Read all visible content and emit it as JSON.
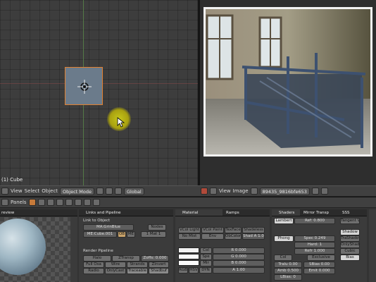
{
  "viewport": {
    "object_label": "(1) Cube",
    "menu": [
      "View",
      "Select",
      "Object"
    ],
    "mode": "Object Mode",
    "orientation": "Global"
  },
  "image_editor": {
    "menu": [
      "View",
      "Image"
    ],
    "image_name": "89435_9816bfe653"
  },
  "buttons_window": {
    "panels_label": "Panels"
  },
  "panel_preview": {
    "title": "review"
  },
  "panel_link": {
    "title": "Links and Pipeline",
    "link_to_object": "Link to Object",
    "material_name": "MA:GrinBlue",
    "nodes": "Nodes",
    "me_name": "ME:Cube.001",
    "ob_btn": "OB",
    "me_btn": "ME",
    "mat_count": "1 Mat 1",
    "render_pipeline": "Render Pipeline",
    "halo": "Halo",
    "ztransp": "ZTransp",
    "zoffs": "Zoffs: 0.000",
    "full_osa": "Full Osa",
    "wire": "Wire",
    "strands": "Strands",
    "zinvert": "ZInvert",
    "radio": "Radio",
    "only_cast": "OnlyCast",
    "traceable": "Traceable",
    "shadbuf": "Shadbuf"
  },
  "panel_material": {
    "tab_material": "Material",
    "tab_ramps": "Ramps",
    "vcol_light": "VCol Light",
    "vcol_paint": "VCol Paint",
    "tex_face": "TexFace",
    "shadeless": "Shadeless",
    "no_mist": "No Mist",
    "env": "Env",
    "obcolor": "ObColor",
    "shad_a": "Shad A 1.00",
    "col_label": "Col",
    "col_r": "R 0.000",
    "spe_label": "Spe",
    "spe_g": "G 0.000",
    "mir_label": "Mir",
    "mir_b": "B 0.000",
    "rgb": "RGB",
    "hsv": "HSV",
    "dyn": "DYN",
    "alpha": "A 1.00"
  },
  "panel_shaders": {
    "tab_shaders": "Shaders",
    "tab_mirror": "Mirror Transp",
    "tab_sss": "SSS",
    "lambert": "Lambert",
    "ref": "Ref: 0.800",
    "tangent": "Tangent V",
    "shadow": "Shadow",
    "phong": "Phong",
    "spec": "Spec 0.249",
    "hard": "Hard: 1",
    "refr": "Refr 1.000",
    "trashadow": "TraShadow",
    "only_shad": "OnlyShad",
    "cubic": "Cubic",
    "bias": "Bias",
    "col_btn": "Col",
    "exclusive": "Exclusive",
    "tralu": "Tralu 0.00",
    "sbias": "SBias 0.00",
    "amb": "Amb 0.500",
    "emit": "Emit 0.000",
    "lbias": "LBias: 0"
  },
  "colors": {
    "accent_orange": "#e08030",
    "cursor_yellow": "#c6c61a",
    "viewport_bg": "#3d3d3d"
  }
}
